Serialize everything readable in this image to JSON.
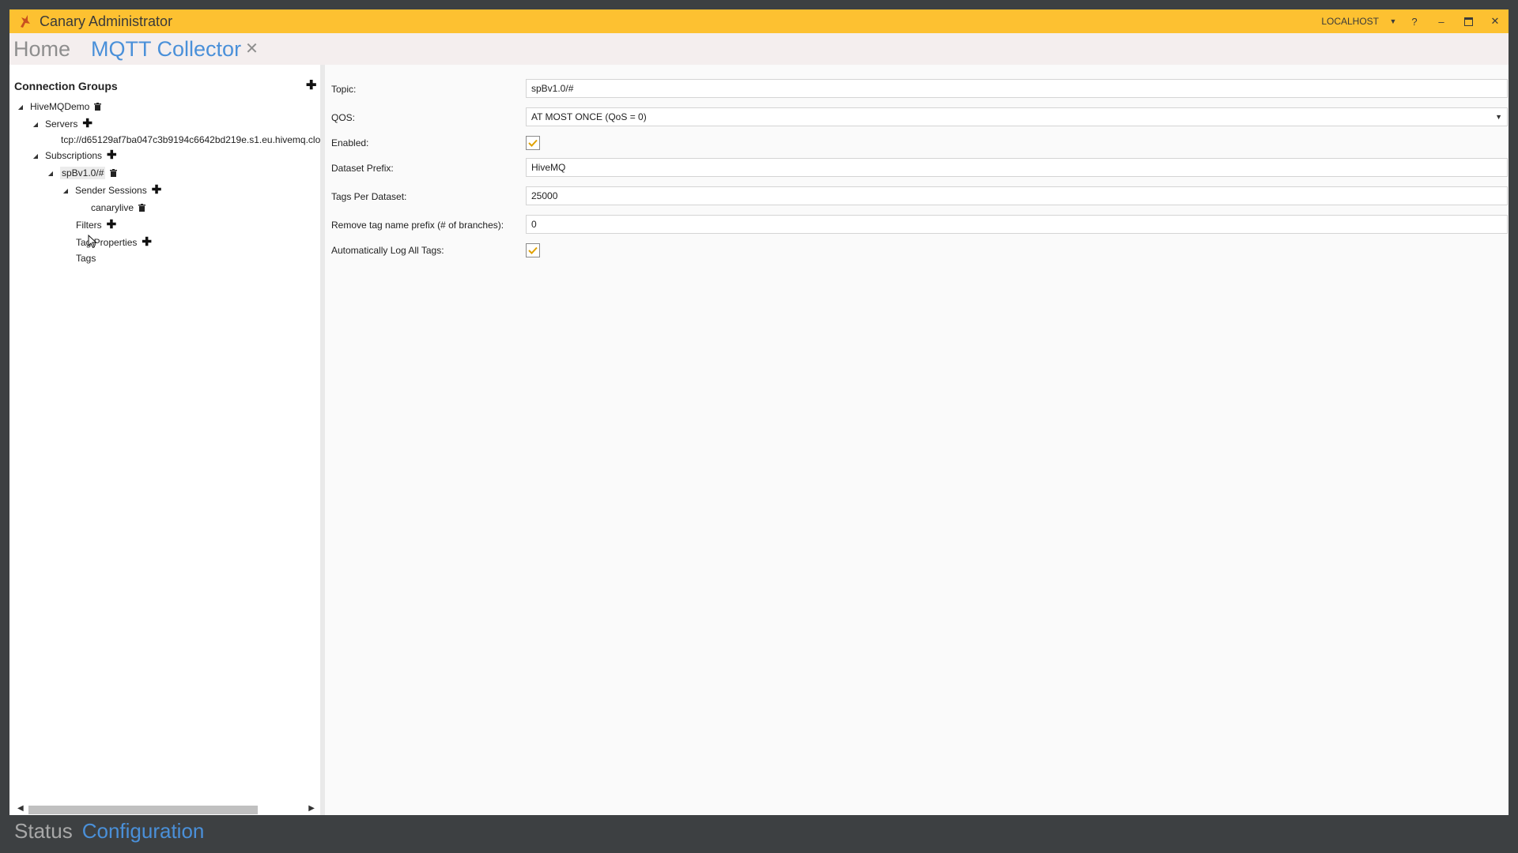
{
  "window": {
    "title": "Canary Administrator",
    "server": "LOCALHOST",
    "help_label": "?",
    "minimize_label": "–",
    "close_label": "✕"
  },
  "tabs": {
    "home": "Home",
    "active": "MQTT Collector",
    "close_label": "✕"
  },
  "tree": {
    "header": "Connection Groups",
    "group": "HiveMQDemo",
    "servers": "Servers",
    "server_url": "tcp://d65129af7ba047c3b9194c6642bd219e.s1.eu.hivemq.clo",
    "subscriptions": "Subscriptions",
    "subscription": "spBv1.0/#",
    "sender_sessions": "Sender Sessions",
    "session": "canarylive",
    "filters": "Filters",
    "tag_properties": "Tag Properties",
    "tags": "Tags"
  },
  "form": {
    "topic_label": "Topic:",
    "topic_value": "spBv1.0/#",
    "qos_label": "QOS:",
    "qos_value": "AT MOST ONCE (QoS = 0)",
    "enabled_label": "Enabled:",
    "enabled": true,
    "dataset_prefix_label": "Dataset Prefix:",
    "dataset_prefix_value": "HiveMQ",
    "tags_per_dataset_label": "Tags Per Dataset:",
    "tags_per_dataset_value": "25000",
    "remove_prefix_label": "Remove tag name prefix (# of branches):",
    "remove_prefix_value": "0",
    "auto_log_label": "Automatically Log All Tags:",
    "auto_log": true
  },
  "footer": {
    "status": "Status",
    "configuration": "Configuration"
  },
  "colors": {
    "titlebar": "#fdc131",
    "accent": "#4a90d9",
    "check": "#e0a100"
  }
}
